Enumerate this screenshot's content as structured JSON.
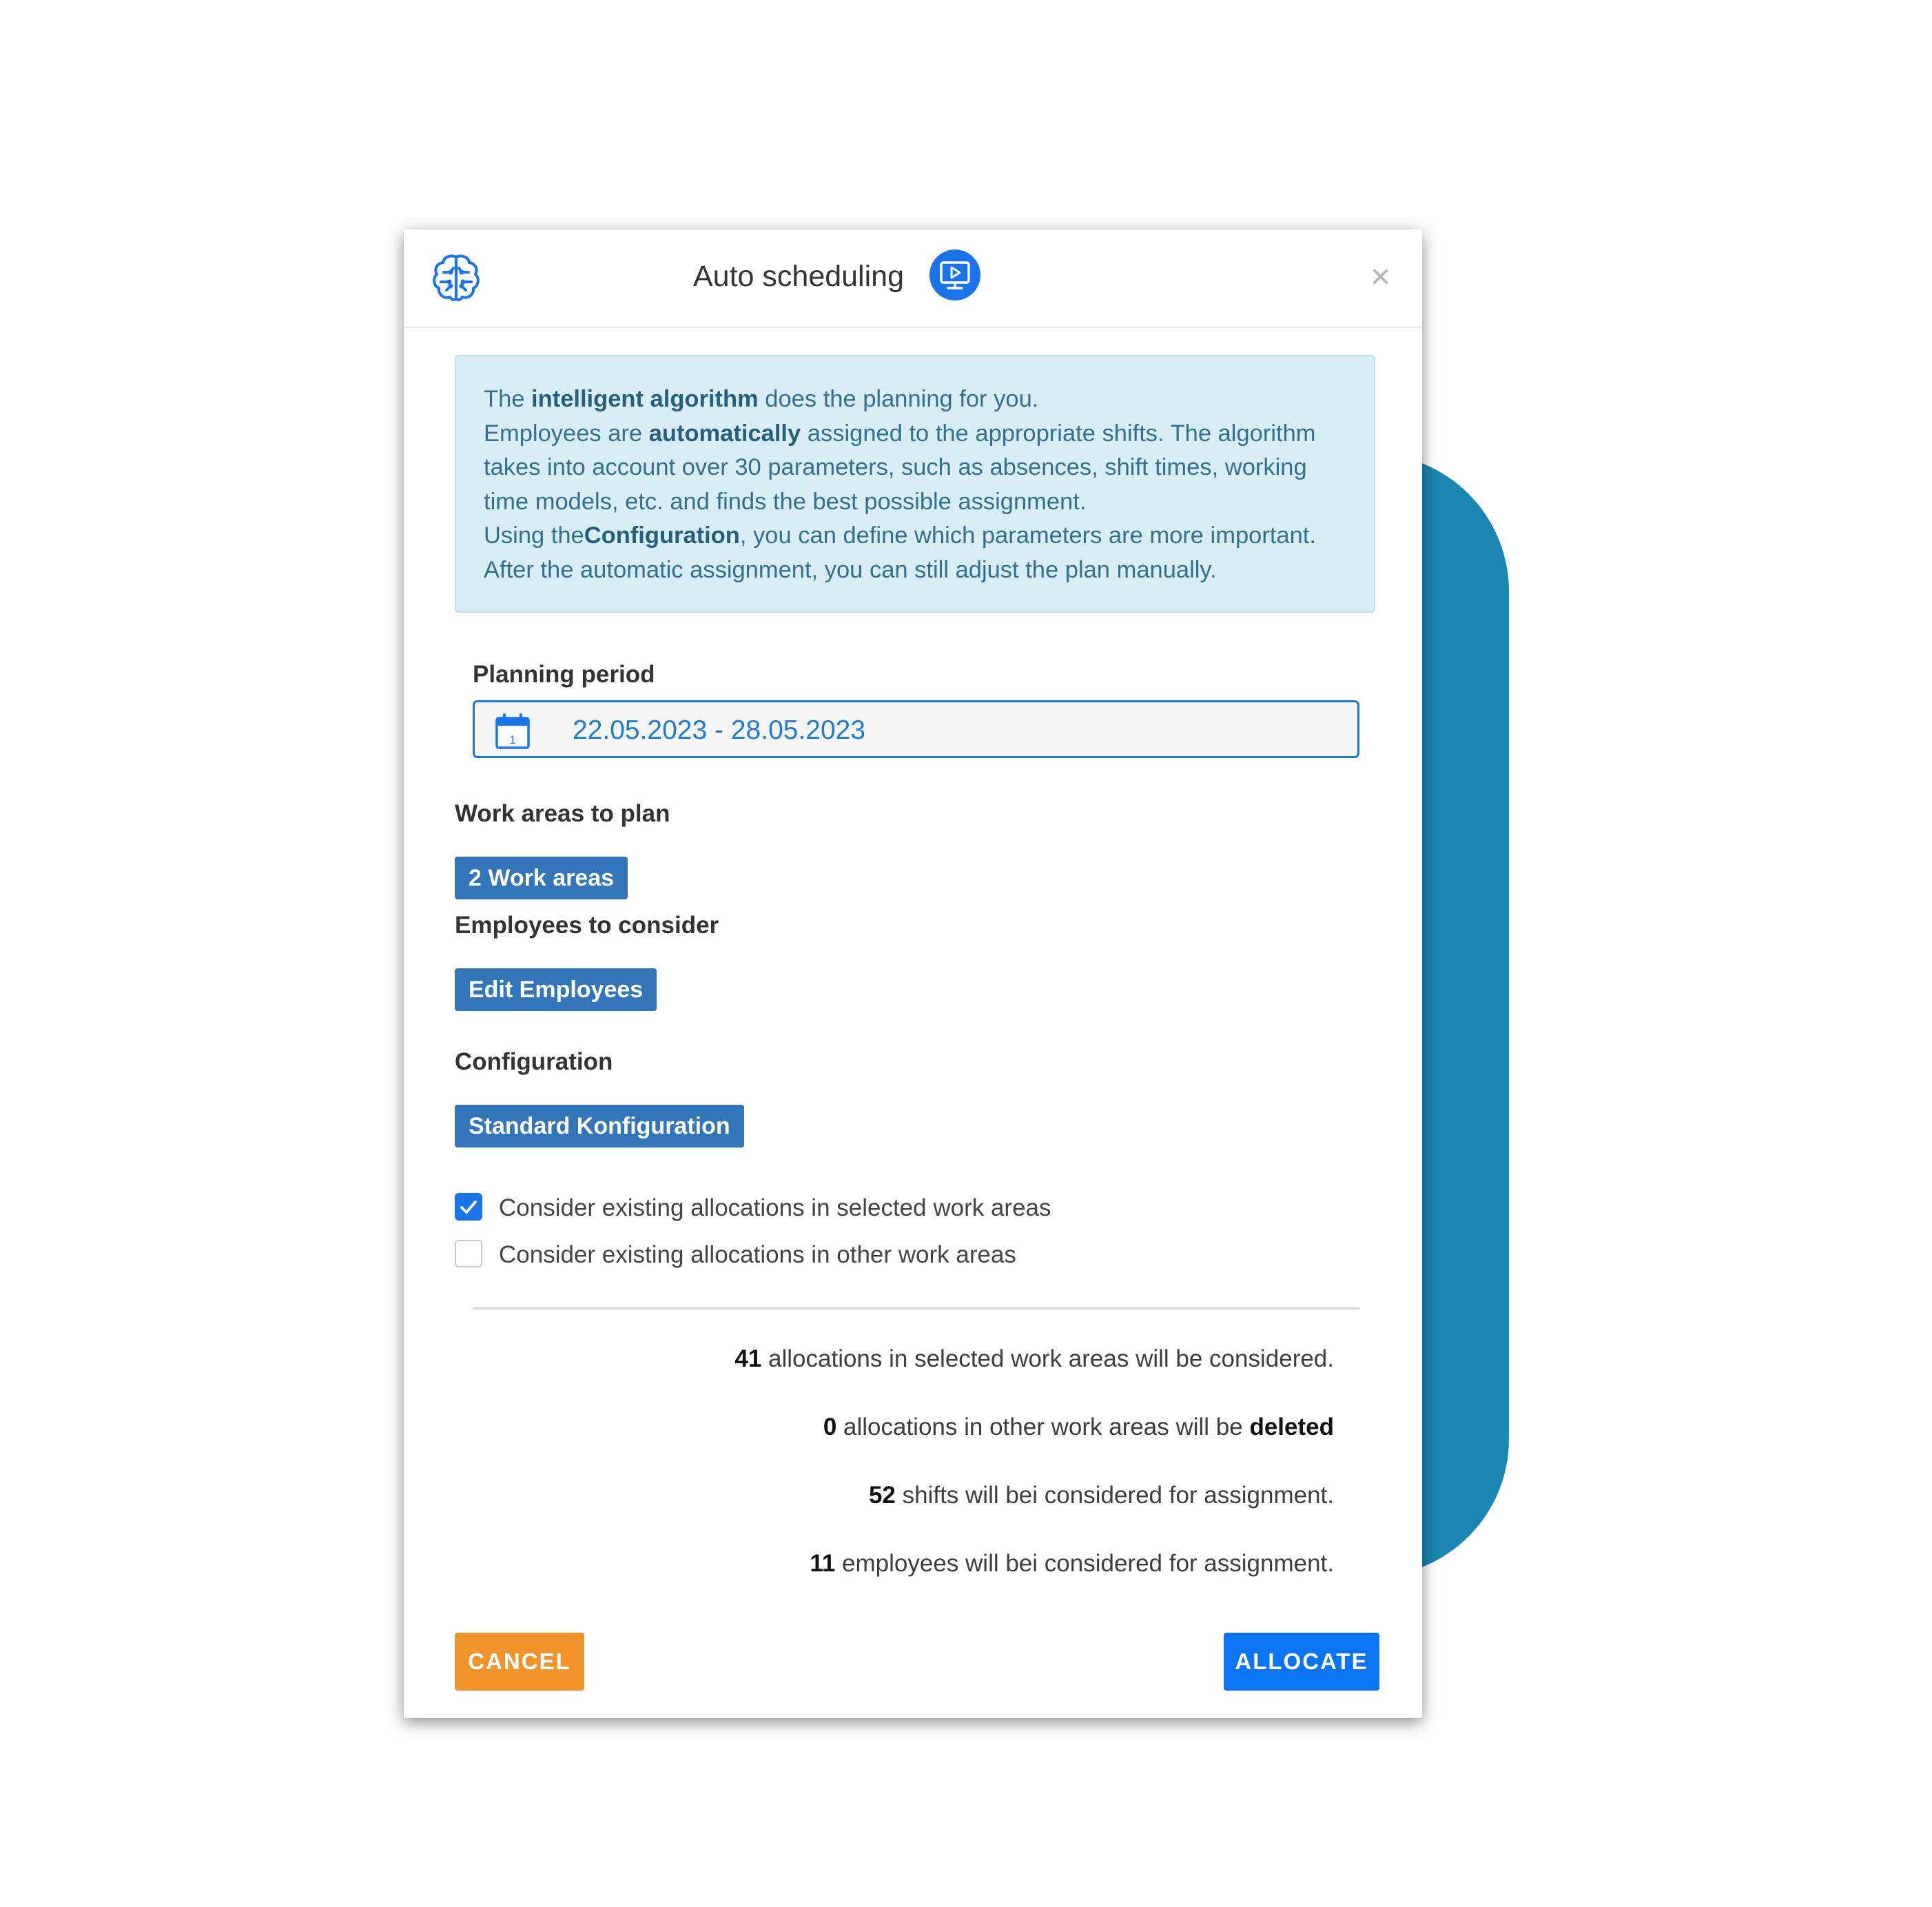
{
  "dialog": {
    "title": "Auto scheduling",
    "close_symbol": "×"
  },
  "icons": {
    "brain": "brain-icon",
    "tutorial": "play-video-icon",
    "calendar": "calendar-icon",
    "check": "check-icon"
  },
  "info": {
    "line1": {
      "pre": "The ",
      "bold": "intelligent algorithm",
      "post": " does the planning for you."
    },
    "line2": {
      "pre": "Employees are ",
      "bold": "automatically",
      "post": " assigned to the appropriate shifts. The algorithm"
    },
    "line3": "takes into account over 30 parameters, such as absences, shift times, working",
    "line4": "time models, etc. and finds the best possible assignment.",
    "line5": {
      "pre": "Using the",
      "bold": "Configuration",
      "post": ", you can define which parameters are more important."
    },
    "line6": "After the automatic assignment, you can still adjust the plan manually."
  },
  "planning": {
    "label": "Planning period",
    "value": "22.05.2023 - 28.05.2023",
    "calendar_day": "1"
  },
  "work_areas": {
    "label": "Work areas to plan",
    "button": "2 Work areas"
  },
  "employees": {
    "label": "Employees to consider",
    "button": "Edit Employees"
  },
  "configuration": {
    "label": "Configuration",
    "button": "Standard Konfiguration"
  },
  "options": [
    {
      "label": "Consider existing allocations in selected work areas",
      "checked": true
    },
    {
      "label": "Consider existing allocations in other work areas",
      "checked": false
    }
  ],
  "summary": [
    {
      "count": "41",
      "text": " allocations in selected work areas will be considered.",
      "tail": ""
    },
    {
      "count": "0",
      "text": " allocations in other work areas will be ",
      "tail": "deleted"
    },
    {
      "count": "52",
      "text": " shifts will bei considered for assignment.",
      "tail": ""
    },
    {
      "count": "11",
      "text": " employees will bei considered for assignment.",
      "tail": ""
    }
  ],
  "actions": {
    "cancel": "CANCEL",
    "allocate": "ALLOCATE"
  },
  "colors": {
    "accent_blue": "#0b74f0",
    "chip_blue": "#3276b9",
    "cancel_orange": "#f0932b",
    "info_bg": "#d9edf7",
    "decor_teal": "#1b86b1"
  }
}
